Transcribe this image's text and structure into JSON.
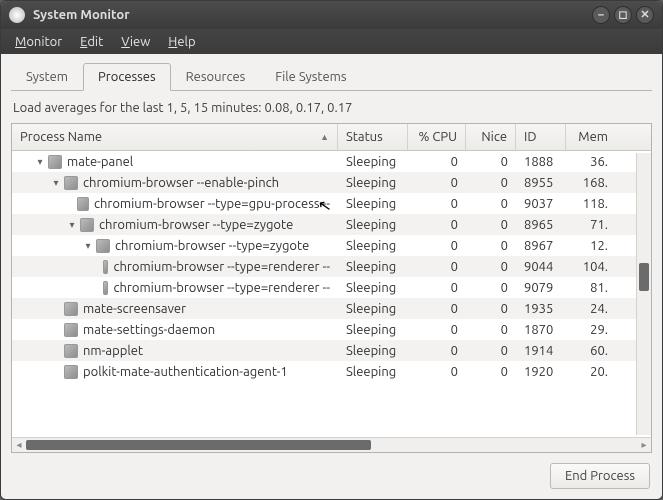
{
  "window": {
    "title": "System Monitor"
  },
  "menu": {
    "monitor": "Monitor",
    "edit": "Edit",
    "view": "View",
    "help": "Help"
  },
  "tabs": {
    "system": "System",
    "processes": "Processes",
    "resources": "Resources",
    "filesystems": "File Systems"
  },
  "loadavg": "Load averages for the last 1, 5, 15 minutes: 0.08, 0.17, 0.17",
  "columns": {
    "name": "Process Name",
    "status": "Status",
    "cpu": "% CPU",
    "nice": "Nice",
    "id": "ID",
    "mem": "Mem"
  },
  "rows": [
    {
      "indent": 1,
      "expander": "▾",
      "name": "mate-panel",
      "status": "Sleeping",
      "cpu": "0",
      "nice": "0",
      "id": "1888",
      "mem": "36."
    },
    {
      "indent": 2,
      "expander": "▾",
      "name": "chromium-browser --enable-pinch",
      "status": "Sleeping",
      "cpu": "0",
      "nice": "0",
      "id": "8955",
      "mem": "168."
    },
    {
      "indent": 3,
      "expander": "",
      "name": "chromium-browser --type=gpu-process --",
      "status": "Sleeping",
      "cpu": "0",
      "nice": "0",
      "id": "9037",
      "mem": "118."
    },
    {
      "indent": 3,
      "expander": "▾",
      "name": "chromium-browser --type=zygote",
      "status": "Sleeping",
      "cpu": "0",
      "nice": "0",
      "id": "8965",
      "mem": "71."
    },
    {
      "indent": 4,
      "expander": "▾",
      "name": "chromium-browser --type=zygote",
      "status": "Sleeping",
      "cpu": "0",
      "nice": "0",
      "id": "8967",
      "mem": "12."
    },
    {
      "indent": 5,
      "expander": "",
      "name": "chromium-browser --type=renderer --",
      "status": "Sleeping",
      "cpu": "0",
      "nice": "0",
      "id": "9044",
      "mem": "104."
    },
    {
      "indent": 5,
      "expander": "",
      "name": "chromium-browser --type=renderer --",
      "status": "Sleeping",
      "cpu": "0",
      "nice": "0",
      "id": "9079",
      "mem": "81."
    },
    {
      "indent": 2,
      "expander": "",
      "name": "mate-screensaver",
      "status": "Sleeping",
      "cpu": "0",
      "nice": "0",
      "id": "1935",
      "mem": "24."
    },
    {
      "indent": 2,
      "expander": "",
      "name": "mate-settings-daemon",
      "status": "Sleeping",
      "cpu": "0",
      "nice": "0",
      "id": "1870",
      "mem": "29."
    },
    {
      "indent": 2,
      "expander": "",
      "name": "nm-applet",
      "status": "Sleeping",
      "cpu": "0",
      "nice": "0",
      "id": "1914",
      "mem": "60."
    },
    {
      "indent": 2,
      "expander": "",
      "name": "polkit-mate-authentication-agent-1",
      "status": "Sleeping",
      "cpu": "0",
      "nice": "0",
      "id": "1920",
      "mem": "20."
    }
  ],
  "footer": {
    "end_process": "End Process"
  }
}
